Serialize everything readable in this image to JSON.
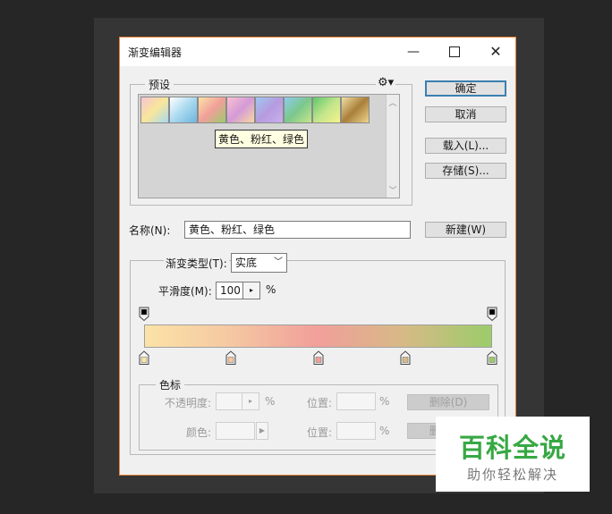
{
  "dialog": {
    "title": "渐变编辑器",
    "window_controls": {
      "minimize": "—",
      "close": "✕"
    }
  },
  "presets": {
    "legend": "预设",
    "gear_icon": "gear-icon",
    "tooltip": "黄色、粉红、绿色",
    "swatches": [
      {
        "name": "rainbow-pastel",
        "colors": [
          "#f7c3d4",
          "#f9e79a",
          "#a7d8f0"
        ]
      },
      {
        "name": "white-blue",
        "colors": [
          "#ffffff",
          "#a9d9ef",
          "#6fb4dc"
        ]
      },
      {
        "name": "yellow-pink-green",
        "colors": [
          "#fbe3a6",
          "#f19f9a",
          "#9ccc6a"
        ]
      },
      {
        "name": "pink-purple",
        "colors": [
          "#f9c0cf",
          "#d49ad7",
          "#f7d9a3"
        ]
      },
      {
        "name": "blue-purple",
        "colors": [
          "#9fc8ef",
          "#b69ae0",
          "#c9b0ea"
        ]
      },
      {
        "name": "blue-green",
        "colors": [
          "#8ccbef",
          "#7cc88c",
          "#c5e68a"
        ]
      },
      {
        "name": "green-yellow",
        "colors": [
          "#5cc86a",
          "#c2e58c",
          "#f7f28a"
        ]
      },
      {
        "name": "gold",
        "colors": [
          "#f2dfa4",
          "#a97f3a",
          "#efd58e"
        ]
      }
    ]
  },
  "buttons": {
    "ok": "确定",
    "cancel": "取消",
    "load": "载入(L)...",
    "save": "存储(S)...",
    "new": "新建(W)",
    "delete_opacity": "删除(D)",
    "delete_color": "删除(D)"
  },
  "name_field": {
    "label": "名称(N):",
    "value": "黄色、粉红、绿色"
  },
  "gradient_type": {
    "label": "渐变类型(T):",
    "value": "实底"
  },
  "smoothness": {
    "label": "平滑度(M):",
    "value": "100",
    "unit": "%"
  },
  "gradient": {
    "colors": [
      "#fbe3a6",
      "#f5c7a2",
      "#f19f9a",
      "#d6ba86",
      "#9ccc6a"
    ],
    "color_stop_locations_percent": [
      0,
      25,
      50,
      75,
      100
    ],
    "opacity_stop_locations_percent": [
      0,
      100
    ]
  },
  "stops_group": {
    "legend": "色标",
    "opacity_label": "不透明度:",
    "opacity_unit": "%",
    "location_label_1": "位置:",
    "location_unit_1": "%",
    "color_label": "颜色:",
    "location_label_2": "位置:",
    "location_unit_2": "%"
  },
  "watermark": {
    "title": "百科全说",
    "subtitle": "助你轻松解决",
    "color": "#37a844"
  }
}
